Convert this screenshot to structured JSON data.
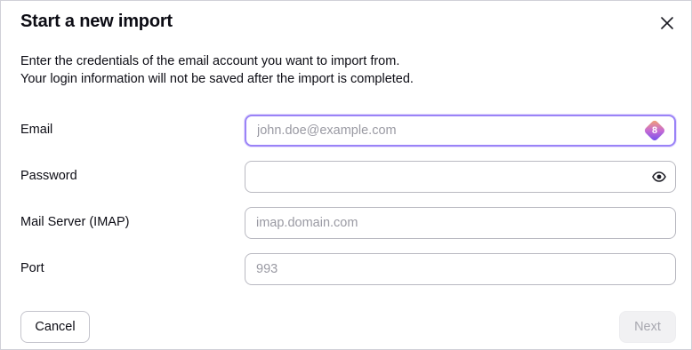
{
  "dialog": {
    "title": "Start a new import",
    "description_line1": "Enter the credentials of the email account you want to import from.",
    "description_line2": "Your login information will not be saved after the import is completed."
  },
  "fields": {
    "email": {
      "label": "Email",
      "placeholder": "john.doe@example.com",
      "value": "",
      "badge_count": "8"
    },
    "password": {
      "label": "Password",
      "placeholder": "",
      "value": ""
    },
    "mail_server": {
      "label": "Mail Server (IMAP)",
      "placeholder": "imap.domain.com",
      "value": ""
    },
    "port": {
      "label": "Port",
      "placeholder": "993",
      "value": ""
    }
  },
  "buttons": {
    "cancel_label": "Cancel",
    "next_label": "Next"
  },
  "colors": {
    "focus_border": "#9a83f7",
    "disabled_bg": "#f1f1f3",
    "text": "#0c0c14",
    "placeholder": "#9a9aa3"
  },
  "icons": {
    "close": "close-icon",
    "password_toggle": "eye-icon",
    "email_badge": "password-manager-badge-icon"
  }
}
